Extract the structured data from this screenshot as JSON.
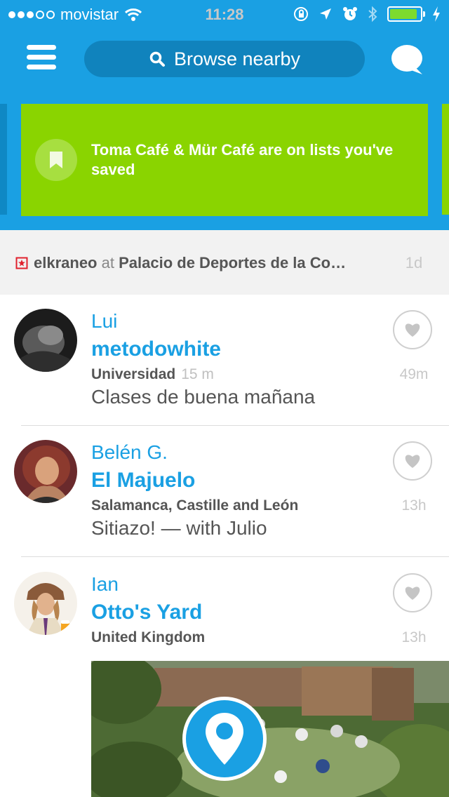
{
  "status_bar": {
    "carrier": "movistar",
    "time": "11:28",
    "signal_bars_filled": 3,
    "signal_bars_total": 5,
    "icons": [
      "wifi-icon",
      "orientation-lock-icon",
      "location-arrow-icon",
      "alarm-icon",
      "bluetooth-icon",
      "battery-icon",
      "charging-bolt-icon"
    ],
    "battery_level": 0.9
  },
  "nav": {
    "menu_icon": "hamburger-menu-icon",
    "search_placeholder": "Browse nearby",
    "search_icon": "search-icon",
    "chat_icon": "chat-bubble-icon"
  },
  "banner": {
    "text": "Toma Café & Mür Café are on lists you've saved",
    "icon": "bookmark-icon",
    "color": "#8ad400"
  },
  "checkin_strip": {
    "user": "elkraneo",
    "at": "at",
    "venue": "Palacio de Deportes de la Co…",
    "time": "1d",
    "icon": "stadium-category-icon"
  },
  "feed": [
    {
      "name": "Lui",
      "venue": "metodowhite",
      "location": "Universidad",
      "distance": "15 m",
      "shout": "Clases de buena mañana",
      "time": "49m"
    },
    {
      "name": "Belén G.",
      "venue": "El Majuelo",
      "location": "Salamanca, Castille and León",
      "distance": "",
      "shout": "Sitiazo! — with Julio",
      "time": "13h"
    },
    {
      "name": "Ian",
      "venue": "Otto's Yard",
      "location": "United Kingdom",
      "distance": "",
      "shout": "",
      "time": "13h"
    }
  ],
  "colors": {
    "brand_blue": "#1aa0e3",
    "brand_green": "#8ad400",
    "muted_text": "#555555"
  }
}
